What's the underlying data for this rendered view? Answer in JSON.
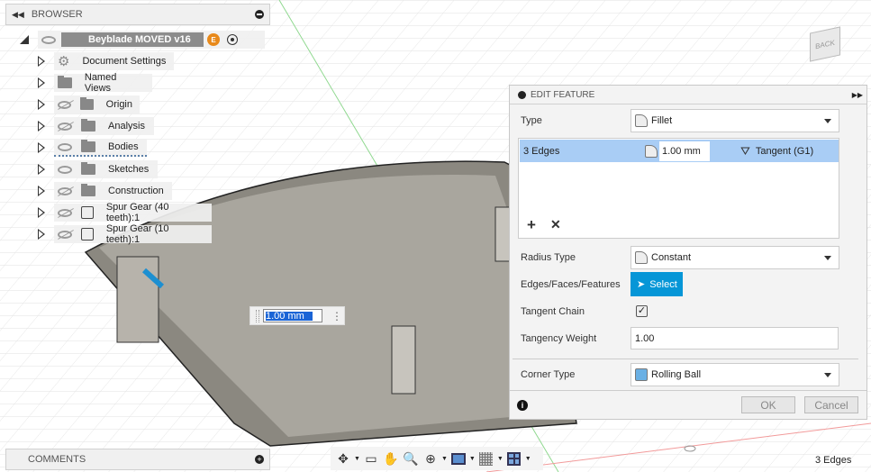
{
  "browser": {
    "title": "BROWSER",
    "root": {
      "label": "Beyblade MOVED v16",
      "badge": "E"
    },
    "items": [
      {
        "label": "Document Settings",
        "icon": "gear-icon",
        "visible": null
      },
      {
        "label": "Named Views",
        "icon": "folder-icon",
        "visible": null
      },
      {
        "label": "Origin",
        "icon": "folder-icon",
        "visible": false
      },
      {
        "label": "Analysis",
        "icon": "folder-icon",
        "visible": false
      },
      {
        "label": "Bodies",
        "icon": "folder-icon",
        "visible": true
      },
      {
        "label": "Sketches",
        "icon": "folder-icon",
        "visible": true
      },
      {
        "label": "Construction",
        "icon": "folder-icon",
        "visible": false
      },
      {
        "label": "Spur Gear (40 teeth):1",
        "icon": "component-icon",
        "visible": false
      },
      {
        "label": "Spur Gear (10 teeth):1",
        "icon": "component-icon",
        "visible": false
      }
    ]
  },
  "comments": {
    "title": "COMMENTS"
  },
  "viewcube": {
    "label": "BACK"
  },
  "dimension_input": {
    "value": "1.00 mm"
  },
  "edit_feature": {
    "title": "EDIT FEATURE",
    "type_label": "Type",
    "type_value": "Fillet",
    "selection": {
      "edges": "3 Edges",
      "radius": "1.00 mm",
      "continuity": "Tangent (G1)"
    },
    "radius_type_label": "Radius Type",
    "radius_type_value": "Constant",
    "edges_label": "Edges/Faces/Features",
    "select_button": "Select",
    "tangent_chain_label": "Tangent Chain",
    "tangent_chain_checked": true,
    "tangency_weight_label": "Tangency Weight",
    "tangency_weight_value": "1.00",
    "corner_type_label": "Corner Type",
    "corner_type_value": "Rolling Ball",
    "ok": "OK",
    "cancel": "Cancel",
    "accent": "#0696d7"
  },
  "status": {
    "selection": "3 Edges"
  }
}
